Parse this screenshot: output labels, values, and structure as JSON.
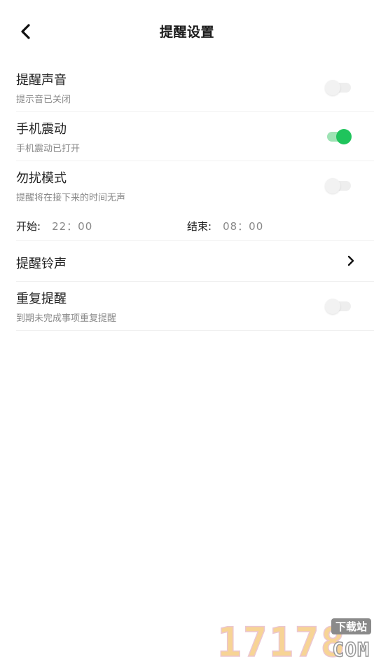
{
  "header": {
    "back_icon": "chevron-left-icon",
    "title": "提醒设置"
  },
  "colors": {
    "accent_green": "#1fc45c",
    "accent_green_light": "#9ee3b4",
    "text_primary": "#222222",
    "text_secondary": "#888888",
    "divider": "#f0f0f0"
  },
  "settings": {
    "sound": {
      "title": "提醒声音",
      "subtitle": "提示音已关闭",
      "enabled": false
    },
    "vibration": {
      "title": "手机震动",
      "subtitle": "手机震动已打开",
      "enabled": true
    },
    "dnd": {
      "title": "勿扰模式",
      "subtitle": "提醒将在接下来的时间无声",
      "enabled": false,
      "start_label": "开始:",
      "start_value": "22：00",
      "end_label": "结束:",
      "end_value": "08：00"
    },
    "ringtone": {
      "title": "提醒铃声",
      "icon": "chevron-right-icon"
    },
    "repeat": {
      "title": "重复提醒",
      "subtitle": "到期未完成事项重复提醒",
      "enabled": false
    }
  },
  "watermark": {
    "number": "17178",
    "badge": "下载站",
    "domain": "COM"
  }
}
